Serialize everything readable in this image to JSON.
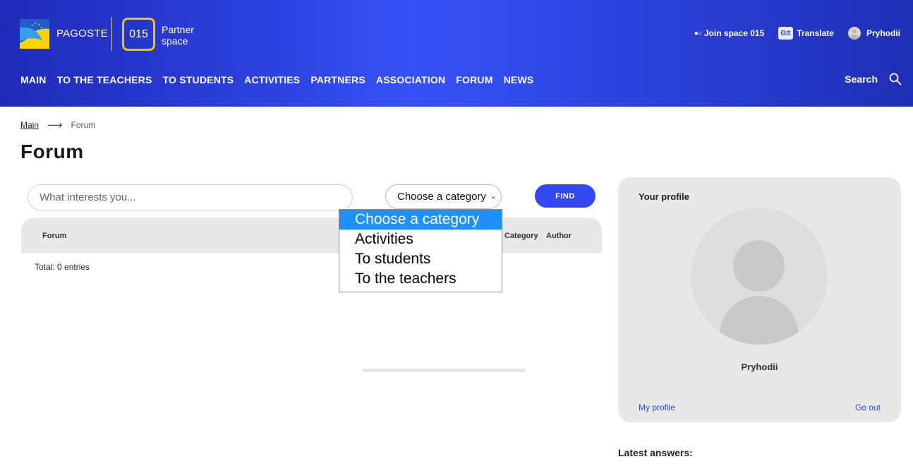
{
  "header": {
    "brand": "PAGOSTE",
    "space_number": "015",
    "space_label_line1": "Partner",
    "space_label_line2": "space",
    "join_label": "Join space 015",
    "join_dots": "●○",
    "translate_label": "Translate",
    "user_name": "Pryhodii",
    "search_label": "Search",
    "colors": {
      "header_blue": "#2f45e2",
      "badge_yellow": "#f5c400",
      "accent_button": "#3347ef"
    }
  },
  "nav": {
    "items": [
      "MAIN",
      "TO THE TEACHERS",
      "TO STUDENTS",
      "ACTIVITIES",
      "PARTNERS",
      "ASSOCIATION",
      "FORUM",
      "NEWS"
    ]
  },
  "breadcrumb": {
    "home": "Main",
    "current": "Forum"
  },
  "page": {
    "title": "Forum"
  },
  "search": {
    "placeholder": "What interests you...",
    "category_selected": "Choose a category",
    "find_label": "FIND",
    "dropdown_options": [
      "Choose a category",
      "Activities",
      "To students",
      "To the teachers"
    ]
  },
  "table": {
    "columns": [
      "Forum",
      "Category",
      "Author"
    ],
    "total": "Total: 0 entries"
  },
  "profile": {
    "title": "Your profile",
    "name": "Pryhodii",
    "my_profile": "My profile",
    "go_out": "Go out"
  },
  "sidebar": {
    "latest_answers": "Latest answers:"
  }
}
